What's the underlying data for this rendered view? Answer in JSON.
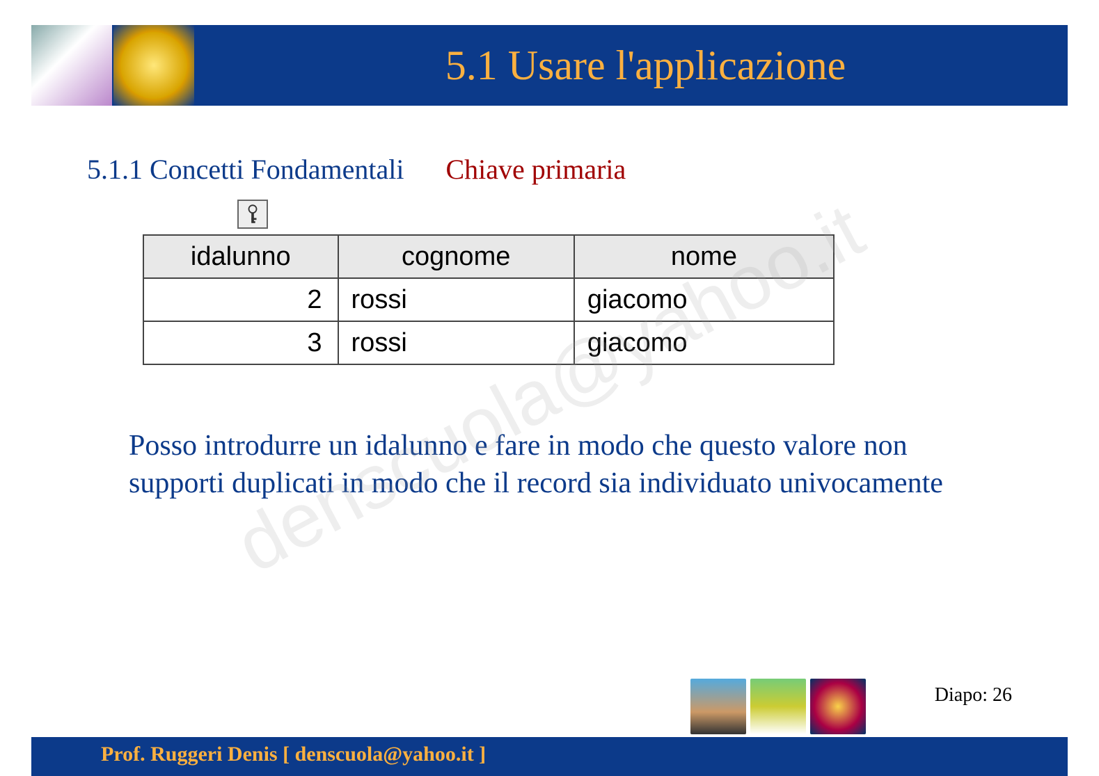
{
  "header": {
    "title": "5.1 Usare l'applicazione"
  },
  "subtitle": {
    "section": "5.1.1 Concetti Fondamentali",
    "topic": "Chiave primaria"
  },
  "table": {
    "headers": {
      "c1": "idalunno",
      "c2": "cognome",
      "c3": "nome"
    },
    "rows": [
      {
        "id": "2",
        "cognome": "rossi",
        "nome": "giacomo"
      },
      {
        "id": "3",
        "cognome": "rossi",
        "nome": "giacomo"
      }
    ]
  },
  "body_text": "Posso introdurre un idalunno e fare in modo che questo valore non supporti duplicati in modo che il record sia individuato univocamente",
  "watermark": "denscuola@yahoo.it",
  "footer": {
    "diapo_label": "Diapo:",
    "diapo_num": "26",
    "author": "Prof. Ruggeri Denis  [ denscuola@yahoo.it ]"
  },
  "icons": {
    "primary_key": "primary-key-icon"
  }
}
